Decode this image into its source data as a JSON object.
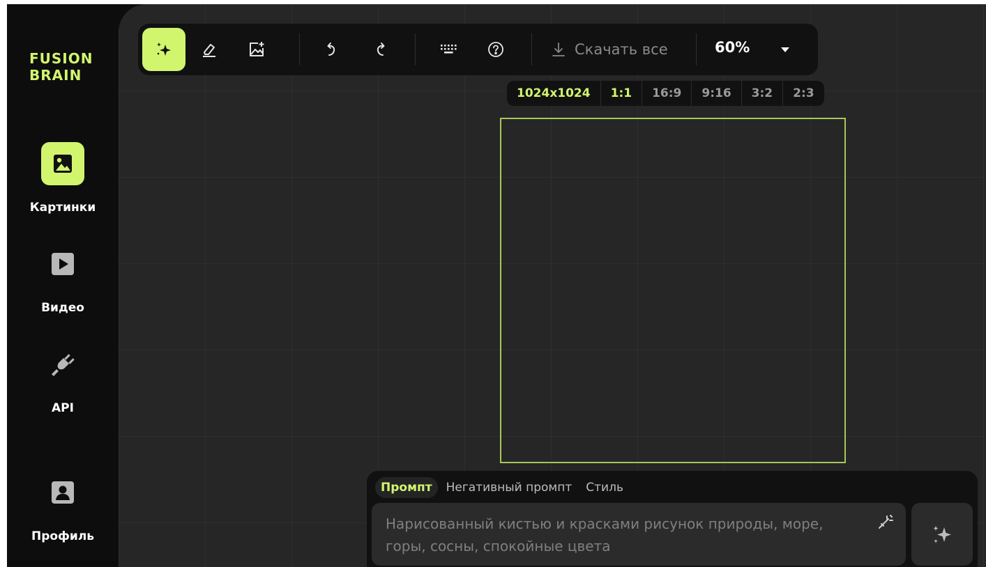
{
  "brand": {
    "line1": "FUSION",
    "line2": "BRAIN",
    "accent": "#d2f56e"
  },
  "sidebar": {
    "items": [
      {
        "label": "Картинки",
        "icon": "image-icon",
        "active": true
      },
      {
        "label": "Видео",
        "icon": "video-icon",
        "active": false
      },
      {
        "label": "API",
        "icon": "plug-icon",
        "active": false
      },
      {
        "label": "Профиль",
        "icon": "profile-icon",
        "active": false
      }
    ]
  },
  "toolbar": {
    "tools": [
      {
        "name": "generate-tool",
        "icon": "sparkle-icon",
        "active": true
      },
      {
        "name": "eraser-tool",
        "icon": "eraser-icon"
      },
      {
        "name": "add-image-tool",
        "icon": "image-plus-icon"
      },
      {
        "name": "undo-button",
        "icon": "undo-icon"
      },
      {
        "name": "redo-button",
        "icon": "redo-icon"
      },
      {
        "name": "keyboard-shortcuts-button",
        "icon": "keyboard-icon"
      },
      {
        "name": "help-button",
        "icon": "help-icon"
      }
    ],
    "download_label": "Скачать все",
    "zoom": "60%"
  },
  "ratio_bar": {
    "size": "1024x1024",
    "ratios": [
      "1:1",
      "16:9",
      "9:16",
      "3:2",
      "2:3"
    ],
    "selected": "1:1"
  },
  "prompt": {
    "tabs": [
      "Промпт",
      "Негативный промпт",
      "Стиль"
    ],
    "active_tab": "Промпт",
    "placeholder": "Нарисованный кистью и красками рисунок природы, море, горы, сосны, спокойные цвета"
  }
}
